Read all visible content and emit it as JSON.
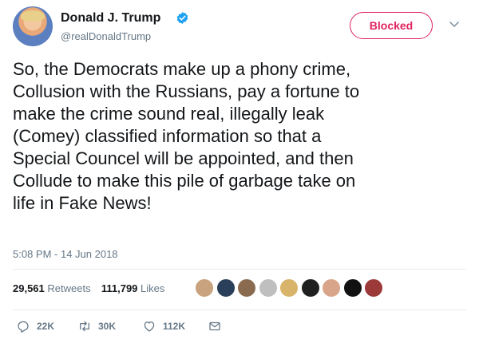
{
  "author": {
    "name": "Donald J. Trump",
    "handle": "@realDonaldTrump"
  },
  "block_button": {
    "label": "Blocked"
  },
  "tweet": {
    "text": "So, the Democrats make up a phony crime,\nCollusion with the Russians, pay a fortune to\nmake the crime sound real, illegally leak\n(Comey) classified information so that a\nSpecial Councel will be appointed, and then\nCollude to make this pile of garbage take on\nlife in Fake News!",
    "timestamp": "5:08 PM - 14 Jun 2018"
  },
  "stats": {
    "retweets_count": "29,561",
    "retweets_label": "Retweets",
    "likes_count": "111,799",
    "likes_label": "Likes"
  },
  "liker_avatars": [
    {
      "color": "#c9a27e"
    },
    {
      "color": "#2a3f5a"
    },
    {
      "color": "#8a6b4f"
    },
    {
      "color": "#bfbfbf"
    },
    {
      "color": "#d8b36a"
    },
    {
      "color": "#1f1f1f"
    },
    {
      "color": "#d9a58a"
    },
    {
      "color": "#111111"
    },
    {
      "color": "#9c3a3a"
    }
  ],
  "actions": {
    "reply_count": "22K",
    "retweet_count": "30K",
    "like_count": "112K"
  },
  "colors": {
    "brand_red": "#e0245e",
    "verified_blue": "#1da1f2",
    "secondary_text": "#657786"
  }
}
